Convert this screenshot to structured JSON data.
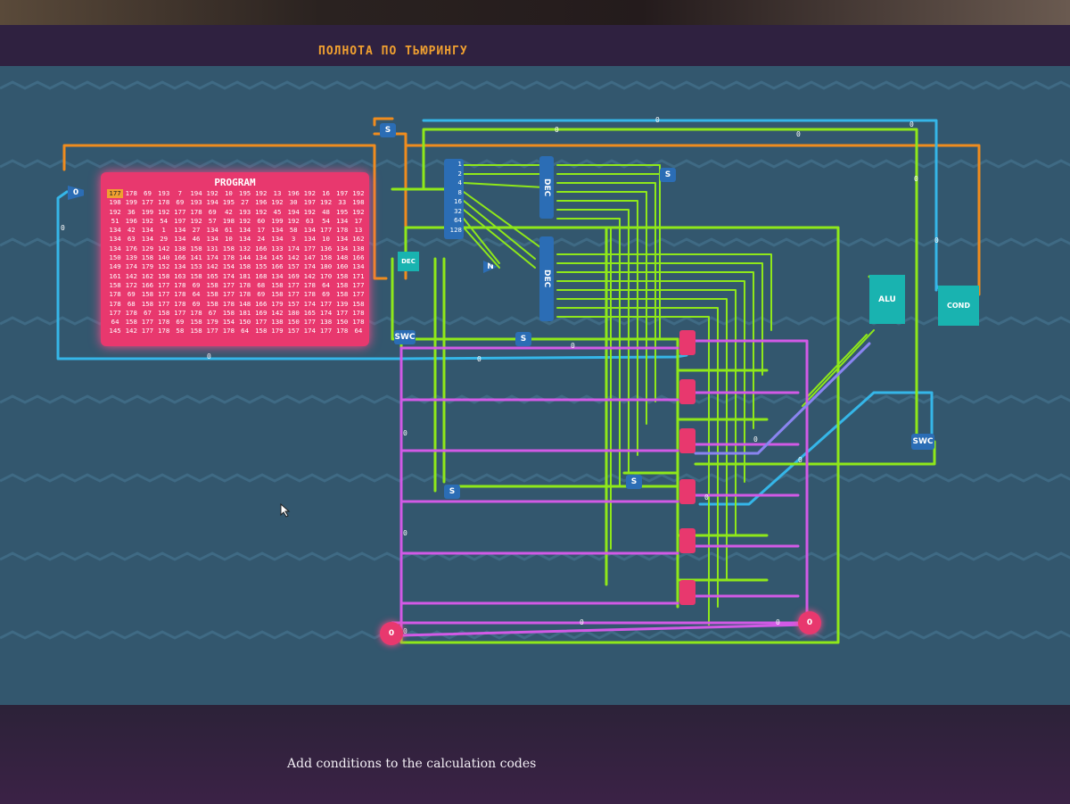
{
  "window": {
    "title": "ПОЛНОТА ПО ТЬЮРИНГУ"
  },
  "objective": {
    "text": "Add conditions to the calculation codes"
  },
  "program": {
    "title": "PROGRAM",
    "current_index": 0,
    "values": [
      "177",
      "178",
      "69",
      "193",
      "7",
      "194",
      "192",
      "10",
      "195",
      "192",
      "13",
      "196",
      "192",
      "16",
      "197",
      "192",
      "198",
      "199",
      "177",
      "178",
      "69",
      "193",
      "194",
      "195",
      "27",
      "196",
      "192",
      "30",
      "197",
      "192",
      "33",
      "198",
      "192",
      "36",
      "199",
      "192",
      "177",
      "178",
      "69",
      "42",
      "193",
      "192",
      "45",
      "194",
      "192",
      "48",
      "195",
      "192",
      "51",
      "196",
      "192",
      "54",
      "197",
      "192",
      "57",
      "198",
      "192",
      "60",
      "199",
      "192",
      "63",
      "54",
      "134",
      "17",
      "134",
      "42",
      "134",
      "1",
      "134",
      "27",
      "134",
      "61",
      "134",
      "17",
      "134",
      "58",
      "134",
      "177",
      "178",
      "13",
      "134",
      "63",
      "134",
      "29",
      "134",
      "46",
      "134",
      "10",
      "134",
      "24",
      "134",
      "3",
      "134",
      "10",
      "134",
      "162",
      "134",
      "176",
      "129",
      "142",
      "138",
      "158",
      "131",
      "158",
      "132",
      "166",
      "133",
      "174",
      "177",
      "136",
      "134",
      "138",
      "150",
      "139",
      "158",
      "140",
      "166",
      "141",
      "174",
      "178",
      "144",
      "134",
      "145",
      "142",
      "147",
      "158",
      "148",
      "166",
      "149",
      "174",
      "179",
      "152",
      "134",
      "153",
      "142",
      "154",
      "158",
      "155",
      "166",
      "157",
      "174",
      "180",
      "160",
      "134",
      "161",
      "142",
      "162",
      "158",
      "163",
      "158",
      "165",
      "174",
      "181",
      "168",
      "134",
      "169",
      "142",
      "170",
      "158",
      "171",
      "158",
      "172",
      "166",
      "177",
      "178",
      "69",
      "158",
      "177",
      "178",
      "68",
      "158",
      "177",
      "178",
      "64",
      "158",
      "177",
      "178",
      "69",
      "158",
      "177",
      "178",
      "64",
      "158",
      "177",
      "178",
      "69",
      "158",
      "177",
      "178",
      "69",
      "158",
      "177",
      "178",
      "68",
      "158",
      "177",
      "178",
      "69",
      "158",
      "178",
      "148",
      "166",
      "179",
      "157",
      "174",
      "177",
      "139",
      "158",
      "177",
      "178",
      "67",
      "158",
      "177",
      "178",
      "67",
      "158",
      "181",
      "169",
      "142",
      "180",
      "165",
      "174",
      "177",
      "178",
      "64",
      "158",
      "177",
      "178",
      "69",
      "158",
      "179",
      "154",
      "150",
      "177",
      "138",
      "150",
      "177",
      "138",
      "150",
      "178",
      "145",
      "142",
      "177",
      "178",
      "58",
      "158",
      "177",
      "178",
      "64",
      "158",
      "179",
      "157",
      "174",
      "177",
      "178",
      "64"
    ]
  },
  "components": {
    "switch_label": "SWC",
    "save_label": "S",
    "decoder_label": "DEC",
    "not_label": "N",
    "alu_label": "ALU",
    "cond_label": "COND",
    "counter_value": "0",
    "bit_labels": [
      "1",
      "2",
      "4",
      "8",
      "16",
      "32",
      "64",
      "128"
    ]
  },
  "wire_values": {
    "zero": "0"
  },
  "colors": {
    "board": "#33576e",
    "wire_green": "#8fe81a",
    "wire_blue": "#35b6e8",
    "wire_orange": "#f08c1e",
    "wire_magenta": "#d25ae6",
    "wire_violet": "#8a84f0",
    "program_block": "#e8386e",
    "title_text": "#f0a030"
  }
}
